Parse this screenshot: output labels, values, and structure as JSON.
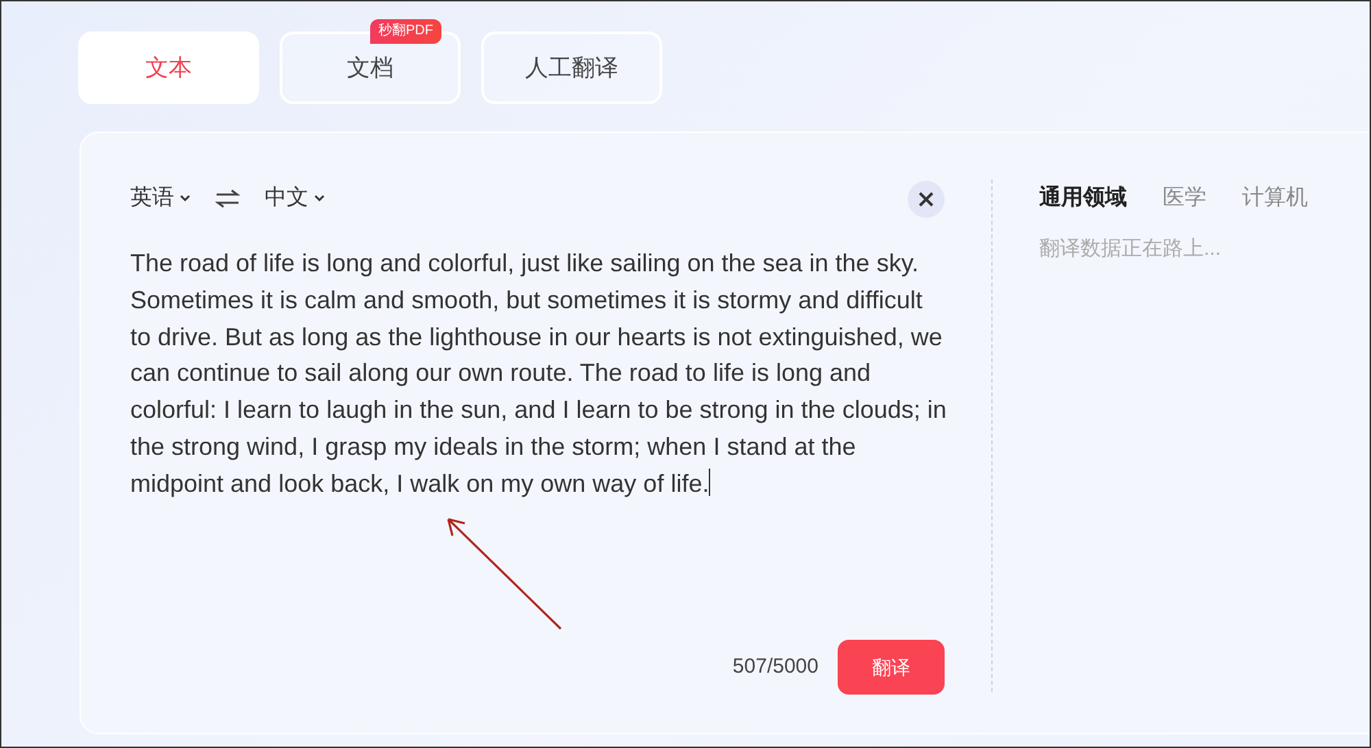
{
  "mode_tabs": [
    {
      "label": "文本",
      "selected": true
    },
    {
      "label": "文档",
      "selected": false,
      "badge": "秒翻PDF"
    },
    {
      "label": "人工翻译",
      "selected": false
    }
  ],
  "source_language": "英语",
  "target_language": "中文",
  "input_text": "The road of life is long and colorful, just like sailing on the sea in the sky. Sometimes it is calm and smooth, but sometimes it is stormy and difficult to drive. But as long as the lighthouse in our hearts is not extinguished, we can continue to sail along our own route. The road to life is long and colorful: I learn to laugh in the sun, and I learn to be strong in the clouds; in the strong wind, I grasp my ideals in the storm; when I stand at the midpoint and look back, I walk on my own way of life.",
  "char_count": "507/5000",
  "translate_button": "翻译",
  "domain_tabs": [
    {
      "label": "通用领域",
      "selected": true
    },
    {
      "label": "医学",
      "selected": false
    },
    {
      "label": "计算机",
      "selected": false
    }
  ],
  "result_placeholder": "翻译数据正在路上..."
}
